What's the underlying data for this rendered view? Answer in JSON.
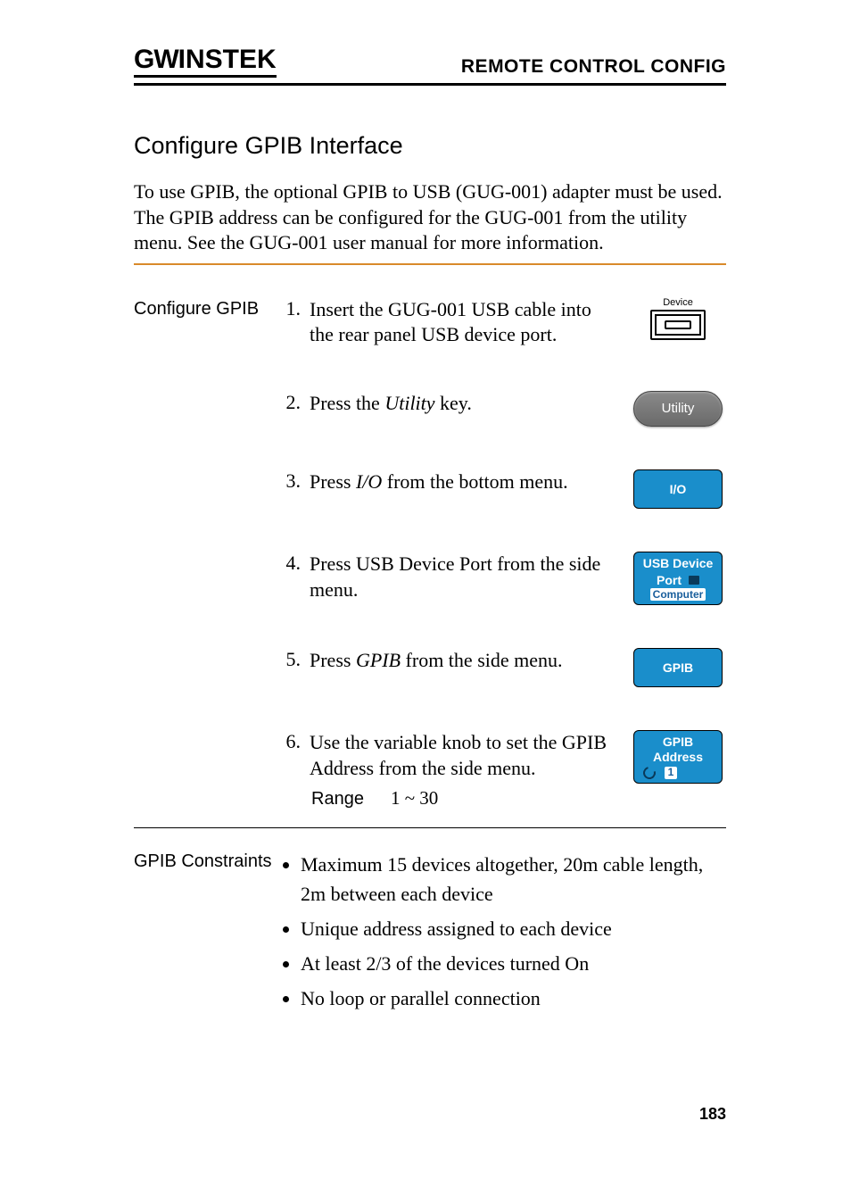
{
  "header": {
    "brand_part1": "GW",
    "brand_part2": "INSTEK",
    "title": "REMOTE CONTROL CONFIG"
  },
  "section_title": "Configure GPIB Interface",
  "intro": "To use GPIB, the optional GPIB to USB (GUG-001) adapter must be used. The GPIB address can be configured for the GUG-001 from the utility menu. See the GUG-001 user manual for more information.",
  "configure": {
    "label": "Configure GPIB",
    "steps": [
      {
        "num": "1.",
        "pre": "Insert the GUG-001 USB cable into the rear panel USB device port.",
        "italic": "",
        "post": "",
        "icon": "device-port",
        "icon_label": "Device"
      },
      {
        "num": "2.",
        "pre": "Press the ",
        "italic": "Utility",
        "post": " key.",
        "icon": "utility",
        "icon_label": "Utility"
      },
      {
        "num": "3.",
        "pre": "Press ",
        "italic": "I/O",
        "post": " from the bottom menu.",
        "icon": "io",
        "icon_label": "I/O"
      },
      {
        "num": "4.",
        "pre": "Press USB Device Port from the side menu.",
        "italic": "",
        "post": "",
        "icon": "usb-device-port",
        "icon_line1": "USB Device",
        "icon_line2": "Port",
        "icon_line3": "Computer"
      },
      {
        "num": "5.",
        "pre": "Press ",
        "italic": "GPIB",
        "post": " from the side menu.",
        "icon": "gpib",
        "icon_label": "GPIB"
      },
      {
        "num": "6.",
        "pre": "Use the variable knob to set the GPIB Address from the side menu.",
        "italic": "",
        "post": "",
        "icon": "gpib-address",
        "icon_line1": "GPIB Address",
        "icon_num": "1"
      }
    ],
    "range_label": "Range",
    "range_value": "1 ~ 30"
  },
  "constraints": {
    "label": "GPIB Constraints",
    "items": [
      "Maximum 15 devices altogether, 20m cable length, 2m between each device",
      "Unique address assigned to each device",
      "At least 2/3 of the devices turned On",
      "No loop or parallel connection"
    ]
  },
  "page_number": "183"
}
